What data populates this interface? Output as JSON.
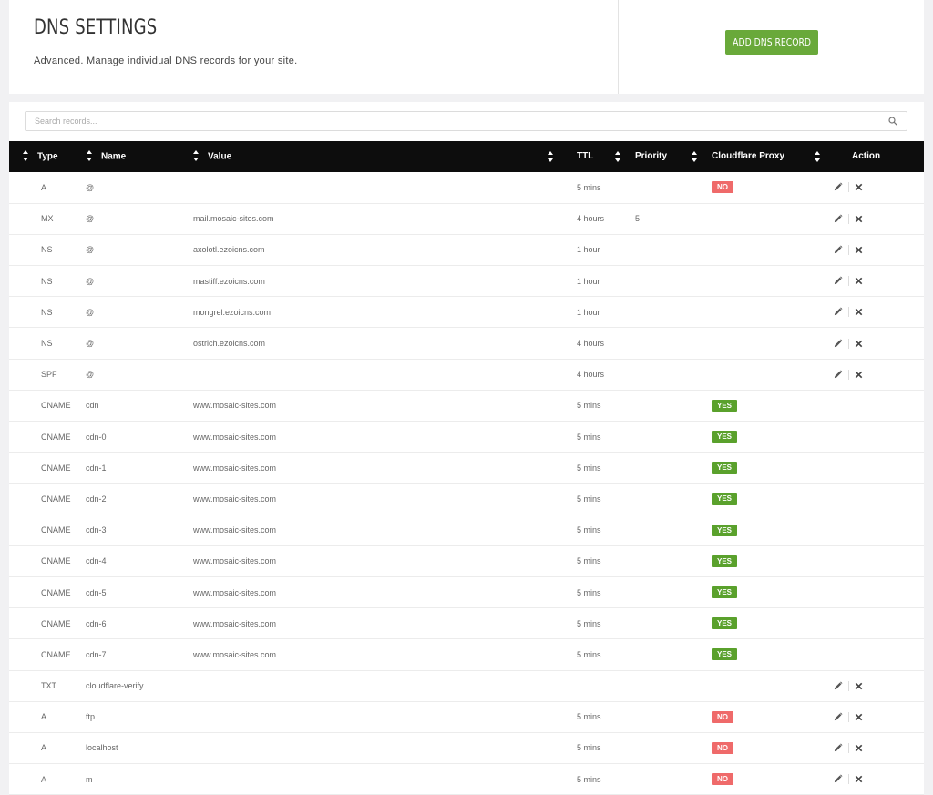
{
  "header": {
    "title": "DNS SETTINGS",
    "subtitle": "Advanced. Manage individual DNS records for your site.",
    "add_button": "ADD DNS RECORD"
  },
  "search": {
    "placeholder": "Search records..."
  },
  "columns": {
    "type": "Type",
    "name": "Name",
    "value": "Value",
    "ttl": "TTL",
    "priority": "Priority",
    "proxy": "Cloudflare Proxy",
    "action": "Action"
  },
  "colors": {
    "accent": "#69a93a",
    "no_badge": "#ef6a6a",
    "yes_badge": "#5aa12c",
    "header_bg": "#0d0d0d"
  },
  "icons": {
    "edit": "pencil-icon",
    "delete": "close-icon",
    "search": "search-icon",
    "sort": "sort-icon"
  },
  "records": [
    {
      "type": "A",
      "name": "@",
      "value": "",
      "ttl": "5 mins",
      "priority": "",
      "proxy": "NO",
      "actions": true
    },
    {
      "type": "MX",
      "name": "@",
      "value": "mail.mosaic-sites.com",
      "ttl": "4 hours",
      "priority": "5",
      "proxy": "",
      "actions": true
    },
    {
      "type": "NS",
      "name": "@",
      "value": "axolotl.ezoicns.com",
      "ttl": "1 hour",
      "priority": "",
      "proxy": "",
      "actions": true
    },
    {
      "type": "NS",
      "name": "@",
      "value": "mastiff.ezoicns.com",
      "ttl": "1 hour",
      "priority": "",
      "proxy": "",
      "actions": true
    },
    {
      "type": "NS",
      "name": "@",
      "value": "mongrel.ezoicns.com",
      "ttl": "1 hour",
      "priority": "",
      "proxy": "",
      "actions": true
    },
    {
      "type": "NS",
      "name": "@",
      "value": "ostrich.ezoicns.com",
      "ttl": "4 hours",
      "priority": "",
      "proxy": "",
      "actions": true
    },
    {
      "type": "SPF",
      "name": "@",
      "value": "",
      "ttl": "4 hours",
      "priority": "",
      "proxy": "",
      "actions": true
    },
    {
      "type": "CNAME",
      "name": "cdn",
      "value": "www.mosaic-sites.com",
      "ttl": "5 mins",
      "priority": "",
      "proxy": "YES",
      "actions": false
    },
    {
      "type": "CNAME",
      "name": "cdn-0",
      "value": "www.mosaic-sites.com",
      "ttl": "5 mins",
      "priority": "",
      "proxy": "YES",
      "actions": false
    },
    {
      "type": "CNAME",
      "name": "cdn-1",
      "value": "www.mosaic-sites.com",
      "ttl": "5 mins",
      "priority": "",
      "proxy": "YES",
      "actions": false
    },
    {
      "type": "CNAME",
      "name": "cdn-2",
      "value": "www.mosaic-sites.com",
      "ttl": "5 mins",
      "priority": "",
      "proxy": "YES",
      "actions": false
    },
    {
      "type": "CNAME",
      "name": "cdn-3",
      "value": "www.mosaic-sites.com",
      "ttl": "5 mins",
      "priority": "",
      "proxy": "YES",
      "actions": false
    },
    {
      "type": "CNAME",
      "name": "cdn-4",
      "value": "www.mosaic-sites.com",
      "ttl": "5 mins",
      "priority": "",
      "proxy": "YES",
      "actions": false
    },
    {
      "type": "CNAME",
      "name": "cdn-5",
      "value": "www.mosaic-sites.com",
      "ttl": "5 mins",
      "priority": "",
      "proxy": "YES",
      "actions": false
    },
    {
      "type": "CNAME",
      "name": "cdn-6",
      "value": "www.mosaic-sites.com",
      "ttl": "5 mins",
      "priority": "",
      "proxy": "YES",
      "actions": false
    },
    {
      "type": "CNAME",
      "name": "cdn-7",
      "value": "www.mosaic-sites.com",
      "ttl": "5 mins",
      "priority": "",
      "proxy": "YES",
      "actions": false
    },
    {
      "type": "TXT",
      "name": "cloudflare-verify",
      "value": "",
      "ttl": "",
      "priority": "",
      "proxy": "",
      "actions": true
    },
    {
      "type": "A",
      "name": "ftp",
      "value": "",
      "ttl": "5 mins",
      "priority": "",
      "proxy": "NO",
      "actions": true
    },
    {
      "type": "A",
      "name": "localhost",
      "value": "",
      "ttl": "5 mins",
      "priority": "",
      "proxy": "NO",
      "actions": true
    },
    {
      "type": "A",
      "name": "m",
      "value": "",
      "ttl": "5 mins",
      "priority": "",
      "proxy": "NO",
      "actions": true
    }
  ]
}
